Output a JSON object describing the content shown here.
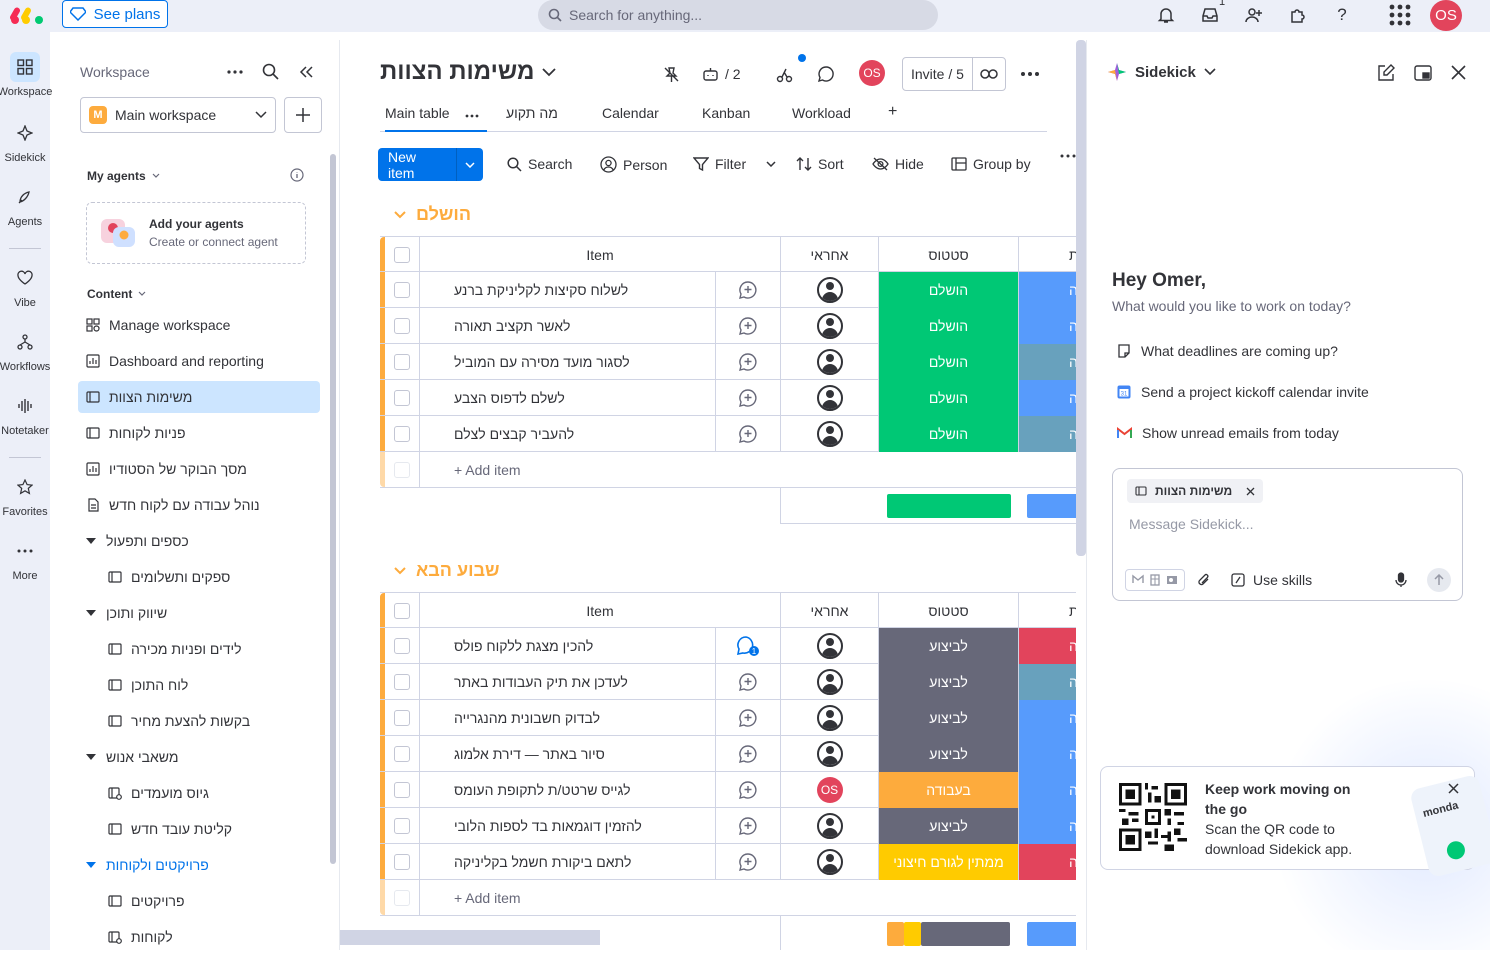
{
  "topbar": {
    "see_plans": "See plans",
    "search_placeholder": "Search for anything...",
    "inbox_badge": "1",
    "avatar": "OS",
    "help": "?"
  },
  "rail": {
    "items": [
      {
        "label": "Workspace",
        "icon": "grid-icon"
      },
      {
        "label": "Sidekick",
        "icon": "sparkle-icon"
      },
      {
        "label": "Agents",
        "icon": "agent-icon"
      },
      {
        "label": "Vibe",
        "icon": "heart-icon"
      },
      {
        "label": "Workflows",
        "icon": "workflow-icon"
      },
      {
        "label": "Notetaker",
        "icon": "audio-wave-icon"
      },
      {
        "label": "Favorites",
        "icon": "star-icon"
      },
      {
        "label": "More",
        "icon": "more-dots-icon"
      }
    ]
  },
  "sidebar": {
    "title": "Workspace",
    "workspace_letter": "M",
    "workspace_name": "Main workspace",
    "my_agents": "My agents",
    "agents_card_title": "Add your agents",
    "agents_card_sub": "Create or connect agent",
    "content": "Content",
    "items": [
      {
        "label": "Manage workspace",
        "icon": "manage-icon"
      },
      {
        "label": "Dashboard and reporting",
        "icon": "dashboard-icon"
      },
      {
        "label": "משימות הצוות",
        "icon": "board-icon",
        "active": true
      },
      {
        "label": "פניות לקוחות",
        "icon": "board-icon"
      },
      {
        "label": "מסך הבוקר של הסטודיו",
        "icon": "dashboard-icon"
      },
      {
        "label": "נוהל עבודה עם לקוח חדש",
        "icon": "doc-icon"
      }
    ],
    "folders": [
      {
        "label": "כספים ותפעול",
        "children": [
          "ספקים ותשלומים"
        ]
      },
      {
        "label": "שיווק ותוכן",
        "children": [
          "לידים ופניות מכירה",
          "לוח התוכן",
          "בקשות להצעת מחיר"
        ]
      },
      {
        "label": "משאבי אנוש",
        "children": [
          "גיוס מועמדים",
          "קליטת עובד חדש"
        ]
      },
      {
        "label": "פרויקטים ולקוחות",
        "children": [
          "פרויקטים",
          "לקוחות"
        ]
      }
    ]
  },
  "board": {
    "title": "משימות הצוות",
    "integrations_count": "/ 2",
    "avatar": "OS",
    "invite": "Invite / 5",
    "tabs": [
      "Main table",
      "מה תקוע",
      "Calendar",
      "Kanban",
      "Workload",
      "+"
    ],
    "new_item": "New item",
    "toolbar": {
      "search": "Search",
      "person": "Person",
      "filter": "Filter",
      "sort": "Sort",
      "hide": "Hide",
      "group_by": "Group by"
    },
    "columns": {
      "item": "Item",
      "owner": "אחראי",
      "status": "סטטוס",
      "next": "ת"
    },
    "add_item": "+ Add item",
    "groups": [
      {
        "title": "הושלם",
        "color": "#fdab3d",
        "rows": [
          {
            "name": "לשלוח סקיצות לקליניקת ברנע",
            "status": "הושלם",
            "status_color": "#00c875",
            "next_color": "#579bfc",
            "next_text": "ה",
            "owner": "person",
            "updates": 0
          },
          {
            "name": "לאשר תקציב תאורה",
            "status": "הושלם",
            "status_color": "#00c875",
            "next_color": "#579bfc",
            "next_text": "ה",
            "owner": "person",
            "updates": 0
          },
          {
            "name": "לסגור מועד מסירה עם המוביל",
            "status": "הושלם",
            "status_color": "#00c875",
            "next_color": "#68a1bd",
            "next_text": "ה",
            "owner": "person",
            "updates": 0
          },
          {
            "name": "לשלם לדפוס הצבע",
            "status": "הושלם",
            "status_color": "#00c875",
            "next_color": "#579bfc",
            "next_text": "ה",
            "owner": "person",
            "updates": 0
          },
          {
            "name": "להעביר קבצים לצלם",
            "status": "הושלם",
            "status_color": "#00c875",
            "next_color": "#68a1bd",
            "next_text": "ה",
            "owner": "person",
            "updates": 0
          }
        ],
        "summary": [
          {
            "color": "#00c875",
            "fraction": 1.0
          }
        ],
        "summary_next": "#579bfc"
      },
      {
        "title": "שבוע הבא",
        "color": "#fdab3d",
        "rows": [
          {
            "name": "להכין מצגת ללקוח פולס",
            "status": "לביצוע",
            "status_color": "#676879",
            "next_color": "#e2445c",
            "next_text": "ה",
            "owner": "person",
            "updates": 1
          },
          {
            "name": "לעדכן את תיק העבודות באתר",
            "status": "לביצוע",
            "status_color": "#676879",
            "next_color": "#68a1bd",
            "next_text": "ה",
            "owner": "person",
            "updates": 0
          },
          {
            "name": "לבדוק חשבונית מהנגרייה",
            "status": "לביצוע",
            "status_color": "#676879",
            "next_color": "#579bfc",
            "next_text": "ה",
            "owner": "person",
            "updates": 0
          },
          {
            "name": "סיור באתר — דירת אלמוג",
            "status": "לביצוע",
            "status_color": "#676879",
            "next_color": "#579bfc",
            "next_text": "ה",
            "owner": "person",
            "updates": 0
          },
          {
            "name": "לגייס שרטט/ת לתקופת העומס",
            "status": "בעבודה",
            "status_color": "#fdab3d",
            "next_color": "#579bfc",
            "next_text": "ה",
            "owner": "OS",
            "updates": 0
          },
          {
            "name": "להזמין דוגמאות בד לספות הלובי",
            "status": "לביצוע",
            "status_color": "#676879",
            "next_color": "#579bfc",
            "next_text": "ה",
            "owner": "person",
            "updates": 0
          },
          {
            "name": "לתאם ביקורת חשמל בקליניקה",
            "status": "ממתין לגורם חיצוני",
            "status_color": "#ffcb00",
            "next_color": "#e2445c",
            "next_text": "ה",
            "owner": "person",
            "updates": 0
          }
        ],
        "summary": [
          {
            "color": "#fdab3d",
            "fraction": 0.14
          },
          {
            "color": "#ffcb00",
            "fraction": 0.14
          },
          {
            "color": "#676879",
            "fraction": 0.72
          }
        ],
        "summary_next": "#579bfc"
      }
    ]
  },
  "sidekick": {
    "title": "Sidekick",
    "greeting": "Hey Omer,",
    "subtitle": "What would you like to work on today?",
    "suggestions": [
      {
        "text": "What deadlines are coming up?",
        "icon": "note-icon"
      },
      {
        "text": "Send a project kickoff calendar invite",
        "icon": "calendar-icon"
      },
      {
        "text": "Show unread emails from today",
        "icon": "gmail-icon"
      }
    ],
    "context_chip": "משימות הצוות",
    "placeholder": "Message Sidekick...",
    "use_skills": "Use skills",
    "promo_title": "Keep work moving on the go",
    "promo_body": "Scan the QR code to download Sidekick app.",
    "promo_logo": "monda"
  }
}
